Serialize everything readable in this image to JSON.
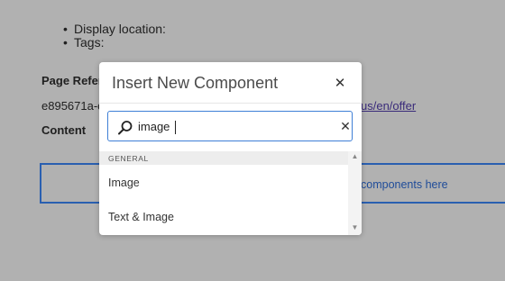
{
  "page": {
    "bullets": [
      "Display location:",
      "Tags:"
    ],
    "page_reference_label": "Page Refere",
    "page_reference_value": "e895671a-c",
    "page_reference_link": "us/en/offer",
    "content_label": "Content",
    "dropzone_text": "components here"
  },
  "dialog": {
    "title": "Insert New Component",
    "close_icon": "close-icon",
    "search": {
      "value": "image",
      "icon": "search-icon"
    },
    "group_label": "GENERAL",
    "items": [
      "Image",
      "Text & Image"
    ]
  },
  "colors": {
    "overlay": "#b1b1b1",
    "accent": "#3e7fd6",
    "dropzone_border": "#2a5fb0"
  }
}
